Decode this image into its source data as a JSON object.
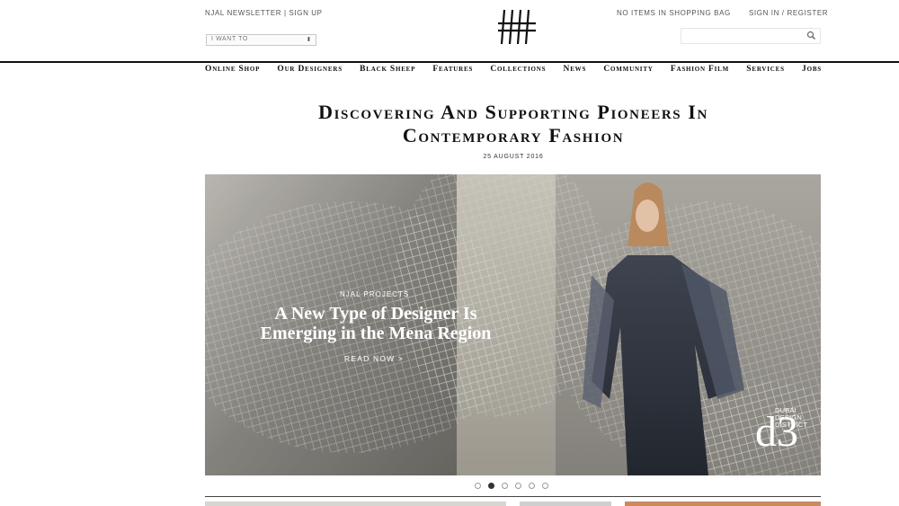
{
  "header": {
    "newsletter_link": "NJAL NEWSLETTER | SIGN UP",
    "select_value": "I WANT TO",
    "bag_status": "NO ITEMS IN SHOPPING BAG",
    "signin_link": "SIGN IN / REGISTER",
    "search_placeholder": ""
  },
  "nav": [
    "Online Shop",
    "Our Designers",
    "Black Sheep",
    "Features",
    "Collections",
    "News",
    "Community",
    "Fashion Film",
    "Services",
    "Jobs"
  ],
  "page": {
    "headline_line1": "Discovering And Supporting Pioneers In",
    "headline_line2": "Contemporary Fashion",
    "date": "25 AUGUST 2016"
  },
  "hero": {
    "kicker": "NJAL PROJECTS",
    "title_line1": "A New Type of Designer Is",
    "title_line2": "Emerging in the Mena Region",
    "cta": "READ NOW >",
    "badge_mark": "d3",
    "badge_word1": "DUBAI",
    "badge_word2": "DESIGN",
    "badge_word3": "DISTRICT"
  },
  "carousel": {
    "count": 6,
    "active": 1
  },
  "colors": {
    "text": "#222222",
    "rule": "#111111",
    "hero_bg": "#9f9c94",
    "thumb_accent": "#c98a60"
  }
}
